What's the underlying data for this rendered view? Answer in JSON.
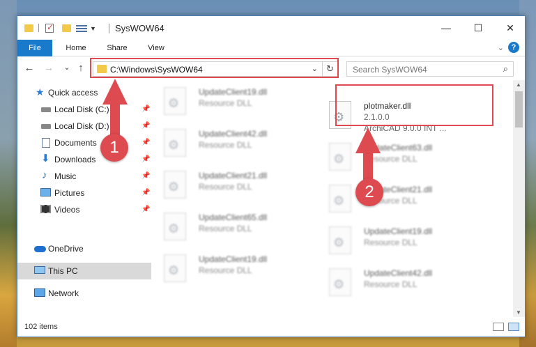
{
  "window": {
    "title": "SysWOW64",
    "controls": {
      "minimize": "—",
      "maximize": "☐",
      "close": "✕"
    }
  },
  "ribbon": {
    "tabs": [
      {
        "label": "File"
      },
      {
        "label": "Home"
      },
      {
        "label": "Share"
      },
      {
        "label": "View"
      }
    ],
    "help": "?"
  },
  "navigation": {
    "back": "←",
    "forward": "→",
    "recent": "⌄",
    "up": "↑",
    "address": "C:\\Windows\\SysWOW64",
    "search_placeholder": "Search SysWOW64"
  },
  "sidebar": {
    "items": [
      {
        "label": "Quick access",
        "icon": "star-icon"
      },
      {
        "label": "Local Disk (C:)",
        "icon": "drive-icon",
        "pinned": true
      },
      {
        "label": "Local Disk (D:)",
        "icon": "drive-icon",
        "pinned": true
      },
      {
        "label": "Documents",
        "icon": "document-icon",
        "pinned": true
      },
      {
        "label": "Downloads",
        "icon": "download-icon",
        "pinned": true
      },
      {
        "label": "Music",
        "icon": "music-icon",
        "pinned": true
      },
      {
        "label": "Pictures",
        "icon": "pictures-icon",
        "pinned": true
      },
      {
        "label": "Videos",
        "icon": "videos-icon",
        "pinned": true
      },
      {
        "label": "OneDrive",
        "icon": "cloud-icon"
      },
      {
        "label": "This PC",
        "icon": "computer-icon",
        "selected": true
      },
      {
        "label": "Network",
        "icon": "network-icon"
      }
    ]
  },
  "files": {
    "left": [
      {
        "name": "UpdateClient19.dll",
        "type": "Resource DLL"
      },
      {
        "name": "UpdateClient42.dll",
        "type": "Resource DLL"
      },
      {
        "name": "UpdateClient21.dll",
        "type": "Resource DLL"
      },
      {
        "name": "UpdateClient65.dll",
        "type": "Resource DLL"
      },
      {
        "name": "UpdateClient19.dll",
        "type": "Resource DLL"
      }
    ],
    "right": [
      {
        "name": "plotmaker.dll",
        "version": "2.1.0.0",
        "description": "ArchiCAD 9.0.0 INT ..."
      },
      {
        "name": "UpdateClient63.dll",
        "type": "Resource DLL"
      },
      {
        "name": "UpdateClient21.dll",
        "type": "Resource DLL"
      },
      {
        "name": "UpdateClient19.dll",
        "type": "Resource DLL"
      },
      {
        "name": "UpdateClient42.dll",
        "type": "Resource DLL"
      }
    ]
  },
  "status": {
    "item_count": "102 items"
  },
  "annotations": {
    "step1": "1",
    "step2": "2",
    "highlight_color": "#e0494f"
  }
}
